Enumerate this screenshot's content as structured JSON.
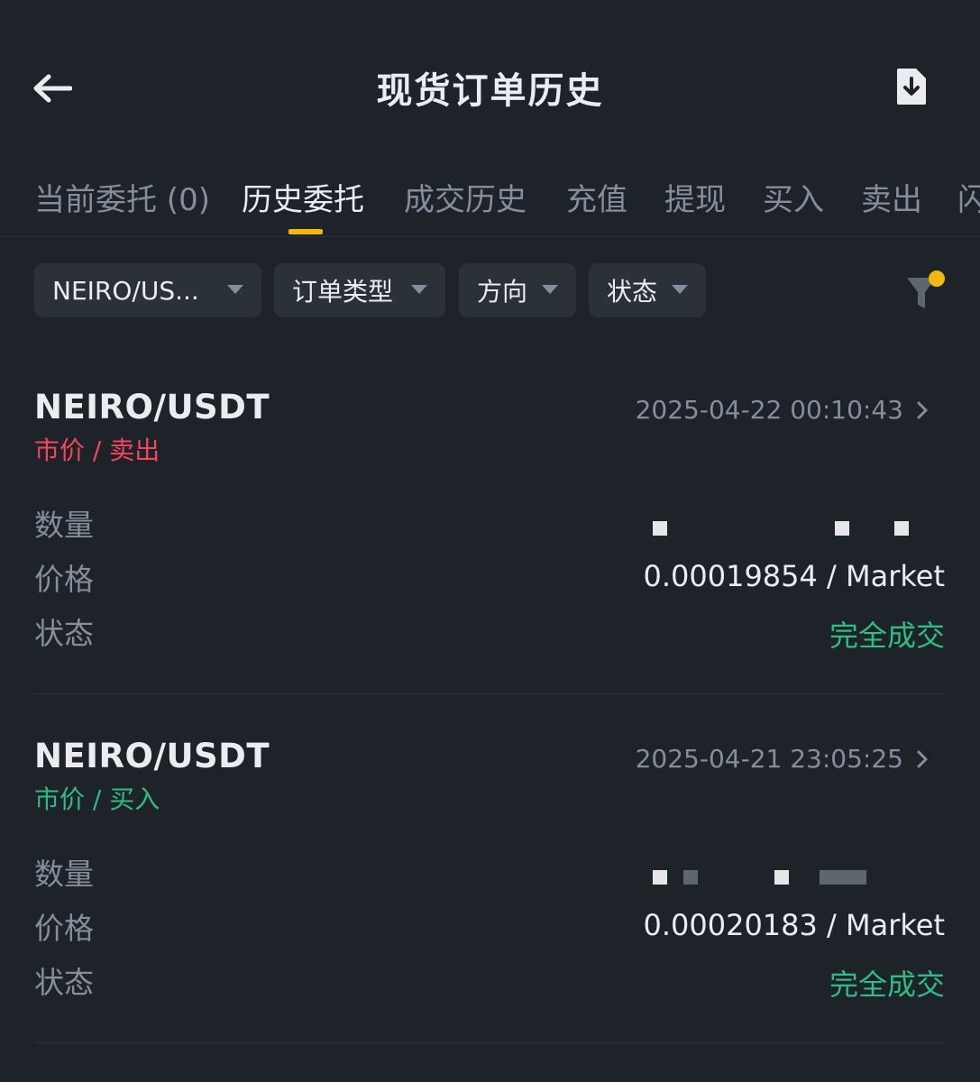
{
  "header": {
    "title": "现货订单历史"
  },
  "tabs": [
    {
      "label": "当前委托 (0)",
      "active": false
    },
    {
      "label": "历史委托",
      "active": true
    },
    {
      "label": "成交历史",
      "active": false
    },
    {
      "label": "充值",
      "active": false
    },
    {
      "label": "提现",
      "active": false
    },
    {
      "label": "买入",
      "active": false
    },
    {
      "label": "卖出",
      "active": false
    },
    {
      "label": "闪",
      "active": false
    }
  ],
  "filters": {
    "pair": "NEIRO/US...",
    "order_type": "订单类型",
    "direction": "方向",
    "status": "状态"
  },
  "labels": {
    "quantity": "数量",
    "price": "价格",
    "status": "状态"
  },
  "orders": [
    {
      "pair": "NEIRO/USDT",
      "side": "市价 / 卖出",
      "side_color": "#f6465d",
      "time": "2025-04-22 00:10:43",
      "price": "0.00019854 / Market",
      "status": "完全成交"
    },
    {
      "pair": "NEIRO/USDT",
      "side": "市价 / 买入",
      "side_color": "#2ebd85",
      "time": "2025-04-21 23:05:25",
      "price": "0.00020183 / Market",
      "status": "完全成交"
    }
  ],
  "colors": {
    "background": "#1e2329",
    "accent": "#f0b90b",
    "sell": "#f6465d",
    "buy": "#2ebd85",
    "muted": "#848e9c",
    "chip": "#2b3139"
  }
}
